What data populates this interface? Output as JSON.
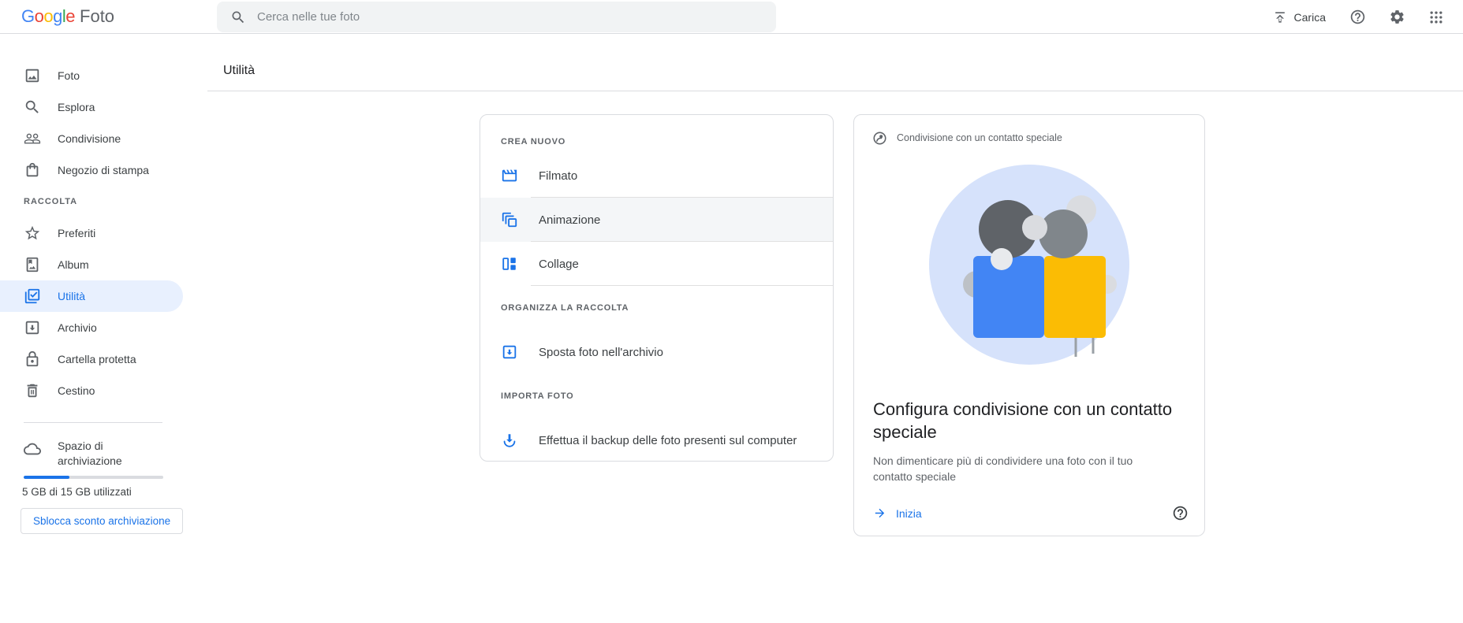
{
  "app": {
    "brand_google": "Google",
    "brand_product": "Foto",
    "logo_letter_colors": [
      "#4285F4",
      "#EA4335",
      "#FBBC05",
      "#4285F4",
      "#34A853",
      "#EA4335"
    ]
  },
  "topbar": {
    "search_placeholder": "Cerca nelle tue foto",
    "upload_label": "Carica"
  },
  "sidebar": {
    "primary_items": [
      {
        "label": "Foto",
        "icon": "photo-icon"
      },
      {
        "label": "Esplora",
        "icon": "search-icon"
      },
      {
        "label": "Condivisione",
        "icon": "people-icon"
      },
      {
        "label": "Negozio di stampa",
        "icon": "shopping-bag-icon"
      }
    ],
    "section_label": "RACCOLTA",
    "collection_items": [
      {
        "label": "Preferiti",
        "icon": "star-icon"
      },
      {
        "label": "Album",
        "icon": "album-icon"
      },
      {
        "label": "Utilità",
        "icon": "utilities-check-icon",
        "selected": true
      },
      {
        "label": "Archivio",
        "icon": "archive-icon"
      },
      {
        "label": "Cartella protetta",
        "icon": "lock-icon"
      },
      {
        "label": "Cestino",
        "icon": "trash-icon"
      }
    ],
    "storage": {
      "label": "Spazio di archiviazione",
      "usage_text": "5 GB di 15 GB utilizzati",
      "percent_used": 33,
      "button_label": "Sblocca sconto archiviazione"
    }
  },
  "main": {
    "page_title": "Utilità",
    "utilities_card": {
      "create_section": {
        "header": "CREA NUOVO",
        "items": [
          {
            "label": "Filmato",
            "icon": "movie-icon"
          },
          {
            "label": "Animazione",
            "icon": "animation-icon",
            "highlighted": true
          },
          {
            "label": "Collage",
            "icon": "collage-icon"
          }
        ]
      },
      "organize_section": {
        "header": "ORGANIZZA LA RACCOLTA",
        "items": [
          {
            "label": "Sposta foto nell'archivio",
            "icon": "archive-move-icon"
          }
        ]
      },
      "import_section": {
        "header": "IMPORTA FOTO",
        "items": [
          {
            "label": "Effettua il backup delle foto presenti sul computer",
            "icon": "download-icon"
          }
        ]
      }
    },
    "promo_card": {
      "header": "Condivisione con un contatto speciale",
      "title": "Configura condivisione con un contatto speciale",
      "description": "Non dimenticare più di condividere una foto con il tuo contatto speciale",
      "action_label": "Inizia"
    }
  },
  "colors": {
    "accent_blue": "#1a73e8",
    "selected_bg": "#e8f0fe",
    "illustration_bg": "#d6e2fb",
    "person_blue": "#4285f4",
    "person_yellow": "#fbbc04",
    "gray_icon": "#5f6368",
    "border": "#dadce0"
  }
}
